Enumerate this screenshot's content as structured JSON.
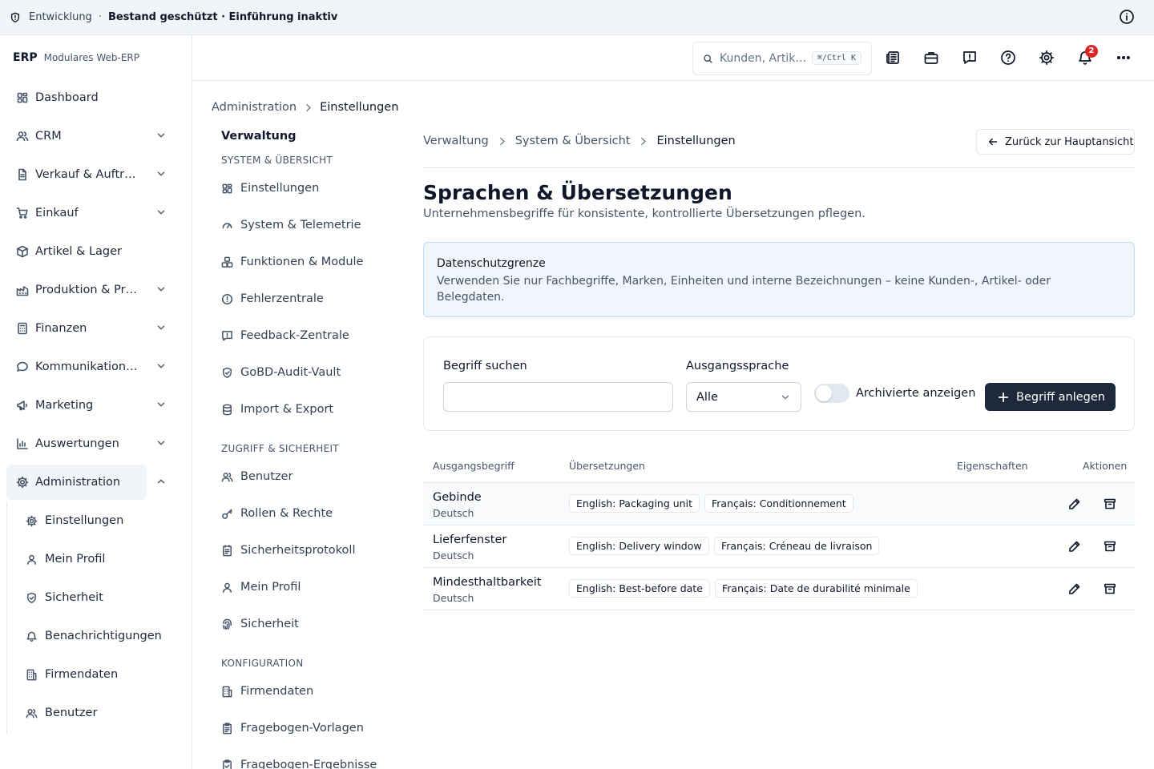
{
  "banner": {
    "environment": "Entwicklung",
    "separator": "·",
    "status": "Bestand geschützt · Einführung inaktiv"
  },
  "brand": {
    "name": "ERP",
    "subtitle": "Modulares Web-ERP"
  },
  "sidebar": {
    "items": [
      {
        "label": "Dashboard",
        "icon": "dashboard-icon",
        "expandable": false
      },
      {
        "label": "CRM",
        "icon": "users-icon",
        "expandable": true
      },
      {
        "label": "Verkauf & Auftr…",
        "icon": "document-icon",
        "expandable": true
      },
      {
        "label": "Einkauf",
        "icon": "cart-icon",
        "expandable": true
      },
      {
        "label": "Artikel & Lager",
        "icon": "package-icon",
        "expandable": false
      },
      {
        "label": "Produktion & Pr…",
        "icon": "factory-icon",
        "expandable": true
      },
      {
        "label": "Finanzen",
        "icon": "calculator-icon",
        "expandable": true
      },
      {
        "label": "Kommunikation…",
        "icon": "message-icon",
        "expandable": true
      },
      {
        "label": "Marketing",
        "icon": "megaphone-icon",
        "expandable": true
      },
      {
        "label": "Auswertungen",
        "icon": "chart-icon",
        "expandable": true
      },
      {
        "label": "Administration",
        "icon": "gear-icon",
        "expandable": true,
        "active": true
      }
    ],
    "subitems": [
      {
        "label": "Einstellungen",
        "icon": "gear-icon"
      },
      {
        "label": "Mein Profil",
        "icon": "user-icon"
      },
      {
        "label": "Sicherheit",
        "icon": "shield-icon"
      },
      {
        "label": "Benachrichtigungen",
        "icon": "bell-icon"
      },
      {
        "label": "Firmendaten",
        "icon": "building-icon"
      },
      {
        "label": "Benutzer",
        "icon": "users-icon"
      }
    ]
  },
  "topbar": {
    "search_placeholder": "Kunden, Artik…",
    "search_shortcut": "⌘/Ctrl K",
    "notification_count": "2"
  },
  "breadcrumb_top": {
    "parent": "Administration",
    "current": "Einstellungen"
  },
  "secondary_nav": {
    "title": "Verwaltung",
    "groups": [
      {
        "label": "SYSTEM & ÜBERSICHT",
        "items": [
          {
            "label": "Einstellungen",
            "icon": "dashboard-icon"
          },
          {
            "label": "System & Telemetrie",
            "icon": "gauge-icon"
          },
          {
            "label": "Funktionen & Module",
            "icon": "boxes-icon"
          },
          {
            "label": "Fehlerzentrale",
            "icon": "alert-circle-icon"
          },
          {
            "label": "Feedback-Zentrale",
            "icon": "message-alert-icon"
          },
          {
            "label": "GoBD-Audit-Vault",
            "icon": "shield-check-icon"
          },
          {
            "label": "Import & Export",
            "icon": "database-icon"
          }
        ]
      },
      {
        "label": "ZUGRIFF & SICHERHEIT",
        "items": [
          {
            "label": "Benutzer",
            "icon": "users-icon"
          },
          {
            "label": "Rollen & Rechte",
            "icon": "key-icon"
          },
          {
            "label": "Sicherheitsprotokoll",
            "icon": "log-icon"
          },
          {
            "label": "Mein Profil",
            "icon": "user-icon"
          },
          {
            "label": "Sicherheit",
            "icon": "fingerprint-icon"
          }
        ]
      },
      {
        "label": "KONFIGURATION",
        "items": [
          {
            "label": "Firmendaten",
            "icon": "building-icon"
          },
          {
            "label": "Fragebogen-Vorlagen",
            "icon": "clipboard-icon"
          },
          {
            "label": "Fragebogen-Ergebnisse",
            "icon": "clipboard-check-icon"
          }
        ]
      }
    ]
  },
  "main": {
    "breadcrumb": [
      "Verwaltung",
      "System & Übersicht",
      "Einstellungen"
    ],
    "back_label": "Zurück zur Hauptansicht",
    "title": "Sprachen & Übersetzungen",
    "subtitle": "Unternehmensbegriffe für konsistente, kontrollierte Übersetzungen pflegen.",
    "notice": {
      "title": "Datenschutzgrenze",
      "text": "Verwenden Sie nur Fachbegriffe, Marken, Einheiten und interne Bezeichnungen – keine Kunden-, Artikel- oder Belegdaten."
    },
    "filters": {
      "search_label": "Begriff suchen",
      "search_value": "",
      "source_lang_label": "Ausgangssprache",
      "source_lang_value": "Alle",
      "archived_label": "Archivierte anzeigen",
      "archived_on": false,
      "create_label": "Begriff anlegen"
    },
    "table": {
      "headers": [
        "Ausgangsbegriff",
        "Übersetzungen",
        "Eigenschaften",
        "Aktionen"
      ],
      "rows": [
        {
          "term": "Gebinde",
          "lang": "Deutsch",
          "translations": [
            "English: Packaging unit",
            "Français: Conditionnement"
          ]
        },
        {
          "term": "Lieferfenster",
          "lang": "Deutsch",
          "translations": [
            "English: Delivery window",
            "Français: Créneau de livraison"
          ]
        },
        {
          "term": "Mindesthaltbarkeit",
          "lang": "Deutsch",
          "translations": [
            "English: Best-before date",
            "Français: Date de durabilité minimale"
          ]
        }
      ]
    }
  },
  "colors": {
    "primary": "#1e293b",
    "badge": "#dc2626",
    "notice_bg": "#f1f5fc",
    "notice_border": "#bfdbfe"
  }
}
